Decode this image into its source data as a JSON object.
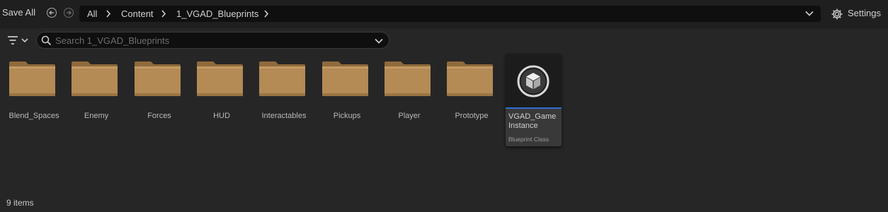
{
  "toolbar": {
    "save_all": "Save All",
    "back_icon": "arrow-left-circle-icon",
    "forward_icon": "arrow-right-circle-icon",
    "breadcrumbs": [
      "All",
      "Content",
      "1_VGAD_Blueprints"
    ],
    "settings_label": "Settings",
    "settings_icon": "gear-icon"
  },
  "search": {
    "placeholder": "Search 1_VGAD_Blueprints",
    "value": ""
  },
  "folders": [
    {
      "name": "Blend_Spaces"
    },
    {
      "name": "Enemy"
    },
    {
      "name": "Forces"
    },
    {
      "name": "HUD"
    },
    {
      "name": "Interactables"
    },
    {
      "name": "Pickups"
    },
    {
      "name": "Player"
    },
    {
      "name": "Prototype"
    }
  ],
  "asset": {
    "name": "VGAD_Game Instance",
    "type": "Blueprint Class",
    "icon": "cube-icon"
  },
  "status": {
    "count": "9 items"
  },
  "colors": {
    "background": "#262626",
    "toolbar": "#1f1f1f",
    "folder": "#b48a55",
    "selection_accent": "#2f6fd6"
  }
}
